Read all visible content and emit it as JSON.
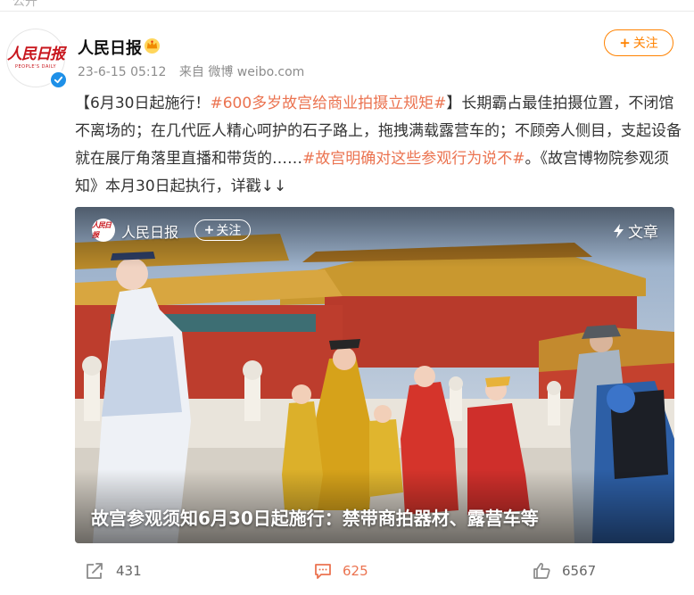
{
  "top": {
    "cut_text": "公开"
  },
  "author": {
    "name": "人民日报",
    "avatar_text": "人民日报",
    "avatar_subtext": "PEOPLE'S DAILY",
    "timestamp": "23-6-15 05:12",
    "source": "来自 微博 weibo.com",
    "follow_label": "关注"
  },
  "post": {
    "segments": [
      {
        "text": "【6月30日起施行！",
        "hl": false
      },
      {
        "text": "#600多岁故宫给商业拍摄立规矩#",
        "hl": true
      },
      {
        "text": "】长期霸占最佳拍摄位置，不闭馆不离场的；在几代匠人精心呵护的石子路上，拖拽满载露营车的；不顾旁人侧目，支起设备就在展厅角落里直播和带货的……",
        "hl": false
      },
      {
        "text": "#故宫明确对这些参观行为说不#",
        "hl": true
      },
      {
        "text": "。《故宫博物院参观须知》本月30日起执行，详戳↓↓",
        "hl": false
      }
    ]
  },
  "card": {
    "author_name": "人民日报",
    "avatar_text": "人民日报",
    "follow_label": "关注",
    "tag": "文章",
    "title": "故宫参观须知6月30日起施行：禁带商拍器材、露营车等"
  },
  "actions": {
    "repost_count": "431",
    "comment_count": "625",
    "like_count": "6567"
  },
  "colors": {
    "accent_orange": "#ff8200",
    "topic_color": "#eb7350",
    "verified_blue": "#1e90e8"
  }
}
